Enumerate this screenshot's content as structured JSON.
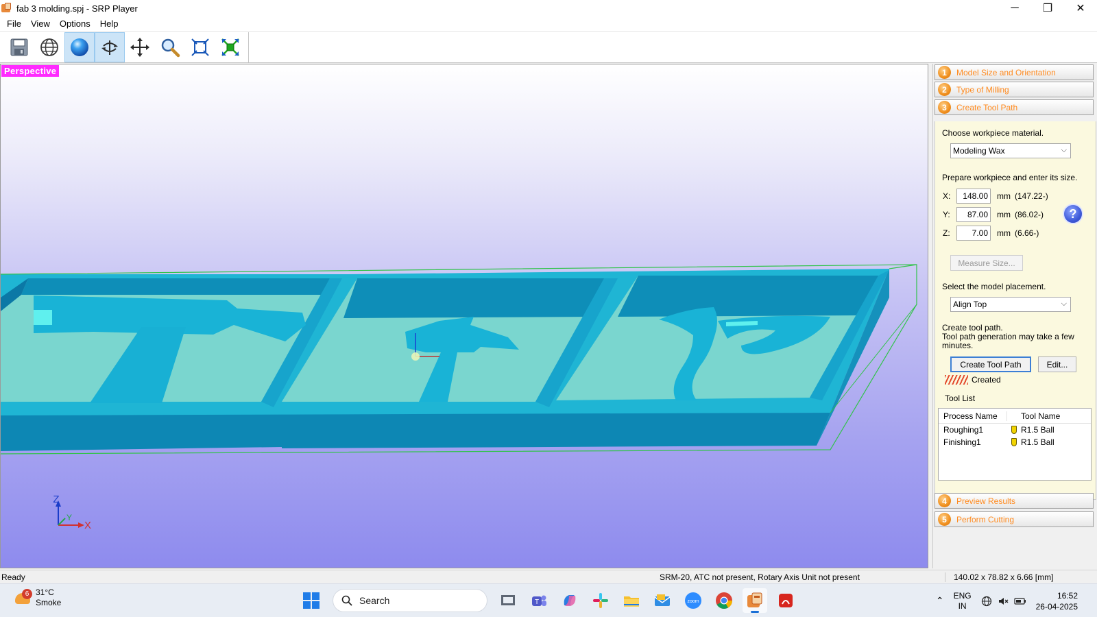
{
  "window": {
    "title": "fab 3 molding.spj - SRP Player",
    "minimize": "─",
    "restore": "❐",
    "close": "✕"
  },
  "menu": [
    "File",
    "View",
    "Options",
    "Help"
  ],
  "toolbar": {
    "buttons": [
      "save-icon",
      "globe-icon",
      "shaded-sphere-icon",
      "rotate-icon",
      "pan-icon",
      "zoom-icon",
      "fit-view-icon",
      "fit-model-icon"
    ]
  },
  "viewport": {
    "label": "Perspective",
    "axes": {
      "z": "Z",
      "y": "Y",
      "x": "X"
    },
    "model_color": "#1bb8d6",
    "label_color": "#ff2bff"
  },
  "panel": {
    "steps": [
      {
        "num": "1",
        "label": "Model Size and Orientation"
      },
      {
        "num": "2",
        "label": "Type of Milling"
      },
      {
        "num": "3",
        "label": "Create Tool Path"
      },
      {
        "num": "4",
        "label": "Preview Results"
      },
      {
        "num": "5",
        "label": "Perform Cutting"
      }
    ],
    "material_prompt": "Choose workpiece material.",
    "material_value": "Modeling Wax",
    "size_prompt": "Prepare workpiece and enter its size.",
    "size": {
      "x": {
        "label": "X:",
        "value": "148.00",
        "unit": "mm",
        "actual": "(147.22-)"
      },
      "y": {
        "label": "Y:",
        "value": "87.00",
        "unit": "mm",
        "actual": "(86.02-)"
      },
      "z": {
        "label": "Z:",
        "value": "7.00",
        "unit": "mm",
        "actual": "(6.66-)"
      }
    },
    "help": "?",
    "measure_button": "Measure Size...",
    "placement_prompt": "Select the model placement.",
    "placement_value": "Align Top",
    "toolpath_prompt_1": "Create tool path.",
    "toolpath_prompt_2": "Tool path generation may take a few minutes.",
    "create_button": "Create Tool Path",
    "edit_button": "Edit...",
    "status": "Created",
    "tool_list": {
      "title": "Tool List",
      "headers": [
        "Process Name",
        "Tool Name"
      ],
      "rows": [
        {
          "process": "Roughing1",
          "tool": "R1.5 Ball"
        },
        {
          "process": "Finishing1",
          "tool": "R1.5 Ball"
        }
      ]
    }
  },
  "statusbar": {
    "left": "Ready",
    "device": "SRM-20, ATC not present, Rotary Axis Unit not present",
    "size": "140.02 x  78.82 x   6.66 [mm]"
  },
  "taskbar": {
    "weather_badge": "6",
    "temperature": "31°C",
    "condition": "Smoke",
    "search": "Search",
    "lang_1": "ENG",
    "lang_2": "IN",
    "time": "16:52",
    "date": "26-04-2025",
    "apps": [
      "start-icon",
      "task-view-icon",
      "teams-icon",
      "copilot-icon",
      "slack-icon",
      "file-explorer-icon",
      "mail-icon",
      "zoom-icon",
      "chrome-icon",
      "srp-player-icon",
      "acrobat-icon"
    ]
  }
}
